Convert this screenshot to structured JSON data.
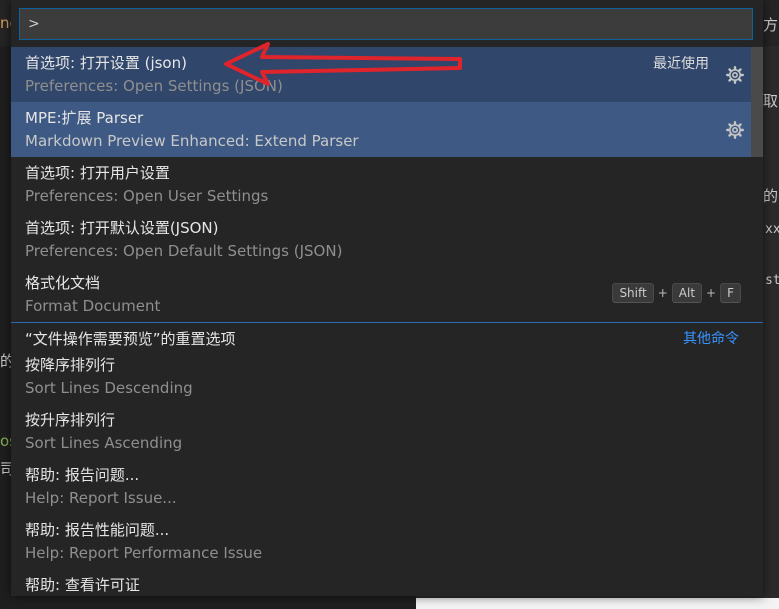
{
  "quick_pick": {
    "input_value": ">",
    "recent_label": "最近使用",
    "other_label": "其他命令",
    "items": [
      {
        "label": "首选项: 打开设置 (json)",
        "detail": "Preferences: Open Settings (JSON)"
      },
      {
        "label": "MPE:扩展 Parser",
        "detail": "Markdown Preview Enhanced: Extend Parser"
      },
      {
        "label": "首选项: 打开用户设置",
        "detail": "Preferences: Open User Settings"
      },
      {
        "label": "首选项: 打开默认设置(JSON)",
        "detail": "Preferences: Open Default Settings (JSON)"
      },
      {
        "label": "格式化文档",
        "detail": "Format Document"
      },
      {
        "label": "“文件操作需要预览”的重置选项"
      },
      {
        "label": "按降序排列行",
        "detail": "Sort Lines Descending"
      },
      {
        "label": "按升序排列行",
        "detail": "Sort Lines Ascending"
      },
      {
        "label": "帮助: 报告问题...",
        "detail": "Help: Report Issue..."
      },
      {
        "label": "帮助: 报告性能问题...",
        "detail": "Help: Report Performance Issue"
      },
      {
        "label": "帮助: 查看许可证"
      }
    ],
    "keybinding": {
      "key1": "Shift",
      "key2": "Alt",
      "key3": "F",
      "plus": "+"
    }
  },
  "background": {
    "top_left": "nc",
    "top_right": "方",
    "right_1": "取",
    "right_2": "的",
    "right_3": "xx",
    "right_4": "st",
    "left_1": "的",
    "left_2": "os",
    "left_3": "司"
  },
  "colors": {
    "accent": "#3794ff",
    "selected": "#3e5a84",
    "arrow": "#e0242c"
  },
  "icons": {
    "gear": "gear-icon",
    "annotation_arrow": "red-arrow"
  }
}
